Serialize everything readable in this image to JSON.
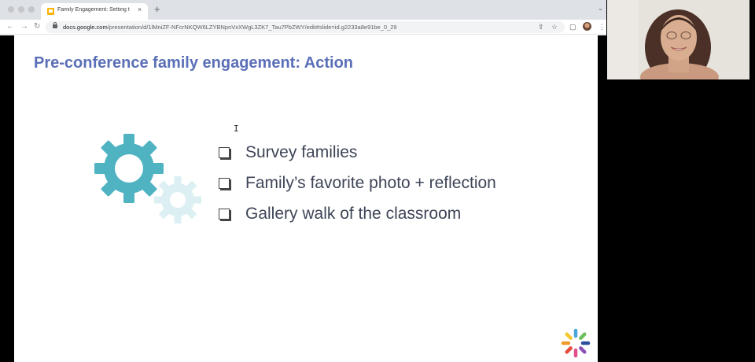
{
  "browser": {
    "tab_title": "Family Engagement: Setting t",
    "tab_close": "×",
    "new_tab": "+",
    "tab_menu": "⌄",
    "url_host": "docs.google.com",
    "url_path": "/presentation/d/1lMniZF-NFcrNKQW6LZYBNpnVxXWgL3ZK7_Tau7PbZWY/edit#slide=id.g2233a8e91be_0_29",
    "nav_back": "←",
    "nav_forward": "→",
    "nav_reload": "↻",
    "icon_share": "⇪",
    "icon_star": "☆",
    "icon_sidebar": "▢",
    "icon_menu": "⋮"
  },
  "slide": {
    "title": "Pre-conference family engagement: Action",
    "bullets": [
      "Survey families",
      "Family’s favorite photo + reflection",
      "Gallery walk of the classroom"
    ],
    "cursor": "I"
  },
  "colors": {
    "title": "#5a6fb7",
    "gear_large": "#4fb3c2",
    "gear_small": "#dcf0f4",
    "bullet_text": "#3e4557",
    "chrome_tabbar": "#dee1e6"
  },
  "icons": {
    "gear_large": "gear-icon",
    "gear_small": "gear-icon",
    "checkbox": "checkbox-icon",
    "logo": "pinwheel-logo",
    "lock": "lock-icon"
  }
}
